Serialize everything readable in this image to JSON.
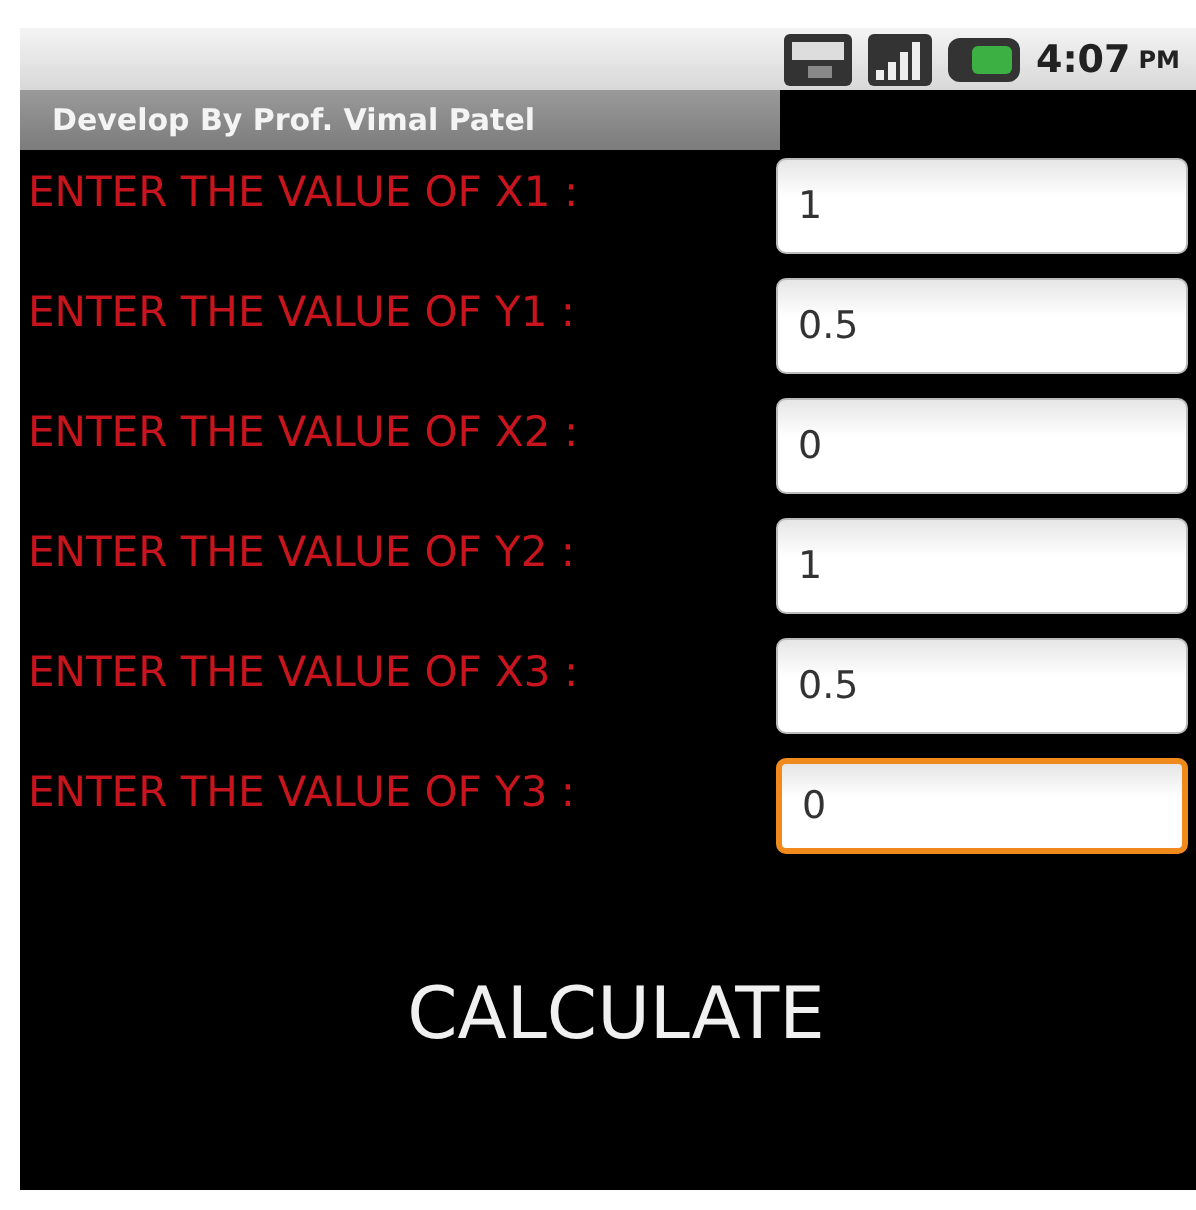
{
  "status_bar": {
    "time": "4:07",
    "meridiem": "PM"
  },
  "title_bar": {
    "title": "Develop By Prof. Vimal Patel"
  },
  "fields": [
    {
      "label": "ENTER THE VALUE OF X1 :",
      "value": "1",
      "focused": false
    },
    {
      "label": "ENTER THE VALUE OF Y1 :",
      "value": "0.5",
      "focused": false
    },
    {
      "label": "ENTER THE VALUE OF X2 :",
      "value": "0",
      "focused": false
    },
    {
      "label": "ENTER THE VALUE OF Y2 :",
      "value": "1",
      "focused": false
    },
    {
      "label": "ENTER THE VALUE OF X3 :",
      "value": "0.5",
      "focused": false
    },
    {
      "label": "ENTER THE VALUE OF Y3 :",
      "value": "0",
      "focused": true
    }
  ],
  "button": {
    "label": "CALCULATE"
  }
}
